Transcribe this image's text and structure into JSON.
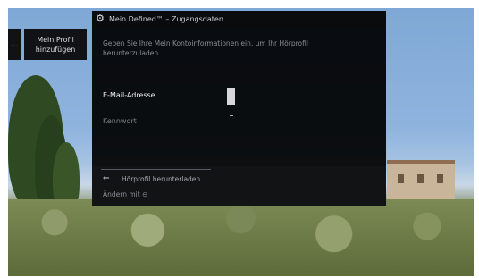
{
  "sidebar": {
    "back_button_label": "...",
    "add_profile_line1": "Mein Profil",
    "add_profile_line2": "hinzufügen"
  },
  "dialog": {
    "title": "Mein Defined™ – Zugangsdaten",
    "intro": "Geben Sie Ihre Mein Kontoinformationen ein, um Ihr Hörprofil herunterzuladen.",
    "email_label": "E-Mail-Adresse",
    "password_label": "Kennwort",
    "back_arrow": "⇐",
    "download_label": "Hörprofil herunterladen",
    "change_label": "Ändern mit ⊖"
  },
  "icons": {
    "settings": "gear-icon",
    "back": "back-arrow-icon"
  },
  "colors": {
    "dialog_bg": "#000000",
    "text_primary": "#e6e8ea",
    "text_dim": "#8a8f95"
  }
}
